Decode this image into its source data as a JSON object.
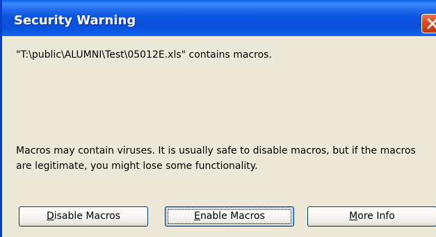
{
  "dialog": {
    "title": "Security Warning",
    "path_message": "\"T:\\public\\ALUMNI\\Test\\05012E.xls\" contains macros.",
    "warning_message": "Macros may contain viruses. It is usually safe to disable macros, but if the macros are legitimate, you might lose some functionality."
  },
  "buttons": {
    "disable": {
      "accel": "D",
      "rest": "isable Macros"
    },
    "enable": {
      "accel": "E",
      "rest": "nable Macros"
    },
    "more_info": {
      "accel": "M",
      "rest": "ore Info"
    }
  },
  "icons": {
    "close": "close-icon"
  },
  "colors": {
    "title_bar": "#0b55e2",
    "close_button": "#d9491c",
    "dialog_background": "#ece9d8"
  }
}
